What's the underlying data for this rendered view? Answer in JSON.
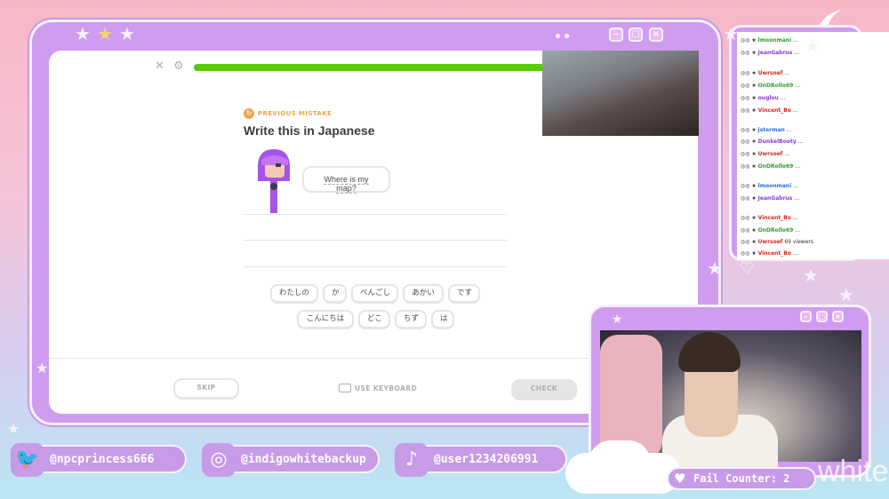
{
  "lesson": {
    "previous_mistake": "PREVIOUS MISTAKE",
    "title": "Write this in Japanese",
    "prompt": "Where is my map?",
    "progress": 1.0,
    "word_bank_row1": [
      "わたしの",
      "か",
      "ぺんごし",
      "あかい",
      "です"
    ],
    "word_bank_row2": [
      "こんにちは",
      "どこ",
      "ちず",
      "は"
    ],
    "skip_label": "SKIP",
    "keyboard_label": "USE KEYBOARD",
    "check_label": "CHECK"
  },
  "chat": [
    {
      "user": "lmoonmani",
      "color": "#2aa02a",
      "text": "..."
    },
    {
      "user": "JeanGabrus",
      "color": "#8a3ad6",
      "text": "..."
    },
    {
      "user": "Uwrsoef",
      "color": "#d9261c",
      "text": "..."
    },
    {
      "user": "OnDRollo69",
      "color": "#2aa02a",
      "text": "..."
    },
    {
      "user": "ouglou",
      "color": "#8a3ad6",
      "text": "..."
    },
    {
      "user": "Vincent_Bo",
      "color": "#d9261c",
      "text": "..."
    },
    {
      "user": "jsterman",
      "color": "#2a6fd6",
      "text": "..."
    },
    {
      "user": "DunkelBooty",
      "color": "#8a3ad6",
      "text": "..."
    },
    {
      "user": "Uwrsoef",
      "color": "#d9261c",
      "text": "..."
    },
    {
      "user": "OnDRollo69",
      "color": "#2aa02a",
      "text": "..."
    },
    {
      "user": "lmoonmani",
      "color": "#2a6fd6",
      "text": "..."
    },
    {
      "user": "JeanGabrus",
      "color": "#8a3ad6",
      "text": "..."
    },
    {
      "user": "Vincent_Bo",
      "color": "#d9261c",
      "text": "..."
    },
    {
      "user": "OnDRollo69",
      "color": "#2aa02a",
      "text": "..."
    },
    {
      "user": "Uwrsoef",
      "color": "#d9261c",
      "text": "69 viewers"
    },
    {
      "user": "Vincent_Bo",
      "color": "#d9261c",
      "text": "..."
    }
  ],
  "socials": {
    "twitter": "@npcprincess666",
    "instagram": "@indigowhitebackup",
    "tiktok": "@user1234206991"
  },
  "fail_counter": "Fail Counter: 2",
  "watermark": "white",
  "colors": {
    "frame": "#cf9cf0",
    "progress": "#58cc02",
    "accent": "#f0a44a"
  }
}
